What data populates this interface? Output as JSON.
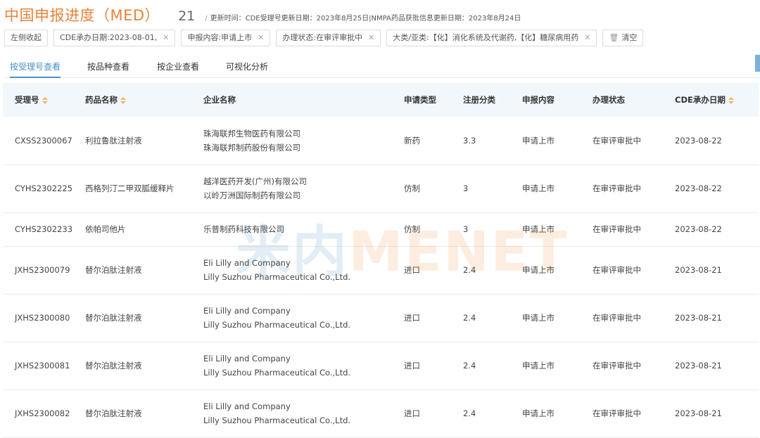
{
  "header": {
    "title": "中国申报进度（MED）",
    "count": "21",
    "update_text": "更新时间：CDE受理号更新日期：2023年8月25日|NMPA药品获批信息更新日期：2023年8月24日"
  },
  "filters": {
    "collapse_label": "左侧收起",
    "chips": [
      "CDE承办日期:2023-08-01,",
      "申报内容:申请上市",
      "办理状态:在审评审批中",
      "大类/亚类:【化】消化系统及代谢药,【化】糖尿病用药"
    ],
    "clear_label": "清空"
  },
  "tabs": [
    "按受理号查看",
    "按品种查看",
    "按企业查看",
    "可视化分析"
  ],
  "table": {
    "headers": [
      "受理号",
      "药品名称",
      "企业名称",
      "申请类型",
      "注册分类",
      "申报内容",
      "办理状态",
      "CDE承办日期"
    ],
    "rows": [
      {
        "id": "CXSS2300067",
        "drug": "利拉鲁肽注射液",
        "companies": [
          "珠海联邦生物医药有限公司",
          "珠海联邦制药股份有限公司"
        ],
        "type": "新药",
        "category": "3.3",
        "content": "申请上市",
        "status": "在审评审批中",
        "date": "2023-08-22"
      },
      {
        "id": "CYHS2302225",
        "drug": "西格列汀二甲双胍缓释片",
        "companies": [
          "越洋医药开发(广州)有限公司",
          "以岭万洲国际制药有限公司"
        ],
        "type": "仿制",
        "category": "3",
        "content": "申请上市",
        "status": "在审评审批中",
        "date": "2023-08-22"
      },
      {
        "id": "CYHS2302233",
        "drug": "依帕司他片",
        "companies": [
          "乐普制药科技有限公司"
        ],
        "type": "仿制",
        "category": "3",
        "content": "申请上市",
        "status": "在审评审批中",
        "date": "2023-08-22"
      },
      {
        "id": "JXHS2300079",
        "drug": "替尔泊肽注射液",
        "companies": [
          "Eli Lilly and Company",
          "Lilly Suzhou Pharmaceutical Co.,Ltd."
        ],
        "type": "进口",
        "category": "2.4",
        "content": "申请上市",
        "status": "在审评审批中",
        "date": "2023-08-21"
      },
      {
        "id": "JXHS2300080",
        "drug": "替尔泊肽注射液",
        "companies": [
          "Eli Lilly and Company",
          "Lilly Suzhou Pharmaceutical Co.,Ltd."
        ],
        "type": "进口",
        "category": "2.4",
        "content": "申请上市",
        "status": "在审评审批中",
        "date": "2023-08-21"
      },
      {
        "id": "JXHS2300081",
        "drug": "替尔泊肽注射液",
        "companies": [
          "Eli Lilly and Company",
          "Lilly Suzhou Pharmaceutical Co.,Ltd."
        ],
        "type": "进口",
        "category": "2.4",
        "content": "申请上市",
        "status": "在审评审批中",
        "date": "2023-08-21"
      },
      {
        "id": "JXHS2300082",
        "drug": "替尔泊肽注射液",
        "companies": [
          "Eli Lilly and Company",
          "Lilly Suzhou Pharmaceutical Co.,Ltd."
        ],
        "type": "进口",
        "category": "2.4",
        "content": "申请上市",
        "status": "在审评审批中",
        "date": "2023-08-21"
      }
    ]
  },
  "watermark": {
    "part1": "米内",
    "part2": "MENET"
  }
}
